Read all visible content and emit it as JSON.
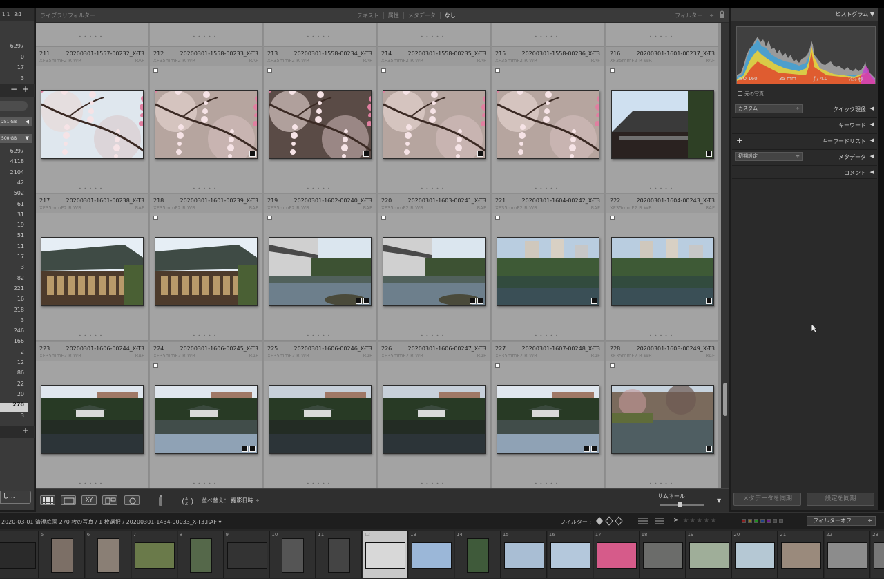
{
  "left_panel": {
    "zoom_labels": [
      "1:1",
      "3:1"
    ],
    "counts_top": [
      "6297",
      "0",
      "17",
      "3"
    ],
    "volumes": [
      "251 GB",
      "500 GB"
    ],
    "counts_folders": [
      "6297",
      "4118",
      "2104",
      "42",
      "502",
      "61",
      "31",
      "19",
      "51",
      "11",
      "17",
      "3",
      "82",
      "221",
      "16",
      "218",
      "3",
      "246",
      "166",
      "2",
      "12",
      "86",
      "22",
      "20",
      "270",
      "3"
    ],
    "selected_count": "270",
    "bottom_button": "し..."
  },
  "filter_bar": {
    "label": "ライブラリフィルター :",
    "options": [
      "テキスト",
      "属性",
      "メタデータ",
      "なし"
    ],
    "active_option": "なし",
    "right_label": "フィルター... ÷"
  },
  "grid": {
    "cells": [
      {
        "index": "211",
        "name": "20200301-1557-00232_X-T3",
        "lens": "XF35mmF2 R WR",
        "ext": "RAF",
        "flag": false,
        "scene": "blossom-sky"
      },
      {
        "index": "212",
        "name": "20200301-1558-00233_X-T3",
        "lens": "XF35mmF2 R WR",
        "ext": "RAF",
        "flag": true,
        "scene": "blossom"
      },
      {
        "index": "213",
        "name": "20200301-1558-00234_X-T3",
        "lens": "XF35mmF2 R WR",
        "ext": "RAF",
        "flag": true,
        "scene": "blossom-dark"
      },
      {
        "index": "214",
        "name": "20200301-1558-00235_X-T3",
        "lens": "XF35mmF2 R WR",
        "ext": "RAF",
        "flag": true,
        "scene": "blossom"
      },
      {
        "index": "215",
        "name": "20200301-1558-00236_X-T3",
        "lens": "XF35mmF2 R WR",
        "ext": "RAF",
        "flag": true,
        "scene": "blossom"
      },
      {
        "index": "216",
        "name": "20200301-1601-00237_X-T3",
        "lens": "XF35mmF2 R WR",
        "ext": "RAF",
        "flag": true,
        "scene": "roof"
      },
      {
        "index": "217",
        "name": "20200301-1601-00238_X-T3",
        "lens": "XF35mmF2 R WR",
        "ext": "RAF",
        "flag": false,
        "scene": "house"
      },
      {
        "index": "218",
        "name": "20200301-1601-00239_X-T3",
        "lens": "XF35mmF2 R WR",
        "ext": "RAF",
        "flag": true,
        "scene": "house"
      },
      {
        "index": "219",
        "name": "20200301-1602-00240_X-T3",
        "lens": "XF35mmF2 R WR",
        "ext": "RAF",
        "flag": true,
        "scene": "pond-house"
      },
      {
        "index": "220",
        "name": "20200301-1603-00241_X-T3",
        "lens": "XF35mmF2 R WR",
        "ext": "RAF",
        "flag": true,
        "scene": "pond-house"
      },
      {
        "index": "221",
        "name": "20200301-1604-00242_X-T3",
        "lens": "XF35mmF2 R WR",
        "ext": "RAF",
        "flag": true,
        "scene": "pond-city"
      },
      {
        "index": "222",
        "name": "20200301-1604-00243_X-T3",
        "lens": "XF35mmF2 R WR",
        "ext": "RAF",
        "flag": true,
        "scene": "pond-city"
      },
      {
        "index": "223",
        "name": "20200301-1606-00244_X-T3",
        "lens": "XF35mmF2 R WR",
        "ext": "RAF",
        "flag": false,
        "scene": "pavilion"
      },
      {
        "index": "224",
        "name": "20200301-1606-00245_X-T3",
        "lens": "XF35mmF2 R WR",
        "ext": "RAF",
        "flag": true,
        "scene": "pavilion-light"
      },
      {
        "index": "225",
        "name": "20200301-1606-00246_X-T3",
        "lens": "XF35mmF2 R WR",
        "ext": "RAF",
        "flag": false,
        "scene": "pavilion-dark"
      },
      {
        "index": "226",
        "name": "20200301-1606-00247_X-T3",
        "lens": "XF35mmF2 R WR",
        "ext": "RAF",
        "flag": false,
        "scene": "pavilion-dark"
      },
      {
        "index": "227",
        "name": "20200301-1607-00248_X-T3",
        "lens": "XF35mmF2 R WR",
        "ext": "RAF",
        "flag": true,
        "scene": "pavilion-light"
      },
      {
        "index": "228",
        "name": "20200301-1608-00249_X-T3",
        "lens": "XF35mmF2 R WR",
        "ext": "RAF",
        "flag": true,
        "scene": "pond-trees"
      }
    ]
  },
  "toolbar": {
    "sort_label": "並べ替え：",
    "sort_value": "撮影日時",
    "thumbnail_label": "サムネール"
  },
  "right_panel": {
    "histogram_title": "ヒストグラム",
    "iso": "ISO 160",
    "focal": "35 mm",
    "aperture": "ƒ / 4.0",
    "shutter": "¹⁄₄₅₀ 秒",
    "original_photo": "元の写真",
    "quick_develop_preset": "カスタム",
    "quick_develop": "クイック現像",
    "keywording": "キーワード",
    "keyword_list": "キーワードリスト",
    "metadata_preset": "初期設定",
    "metadata": "メタデータ",
    "comments": "コメント",
    "sync_metadata": "メタデータを同期",
    "sync_settings": "設定を同期"
  },
  "filmstrip_bar": {
    "path": "2020-03-01 清澄庭園  270 枚の写真 / 1 枚選択 / 20200301-1434-00033_X-T3.RAF ▾",
    "filter_label": "フィルター :",
    "filter_off": "フィルターオフ"
  },
  "filmstrip": {
    "numbers": [
      "",
      "5",
      "6",
      "7",
      "8",
      "9",
      "10",
      "11",
      "12",
      "13",
      "14",
      "15",
      "16",
      "17",
      "18",
      "19",
      "20",
      "21",
      "22",
      "23"
    ],
    "selected_index": 8
  },
  "colors": {
    "grid_bg": "#8e8e8e",
    "cell_bg": "#a3a3a3",
    "panel_bg": "#2a2a2a",
    "selection": "#d0d0d0"
  }
}
